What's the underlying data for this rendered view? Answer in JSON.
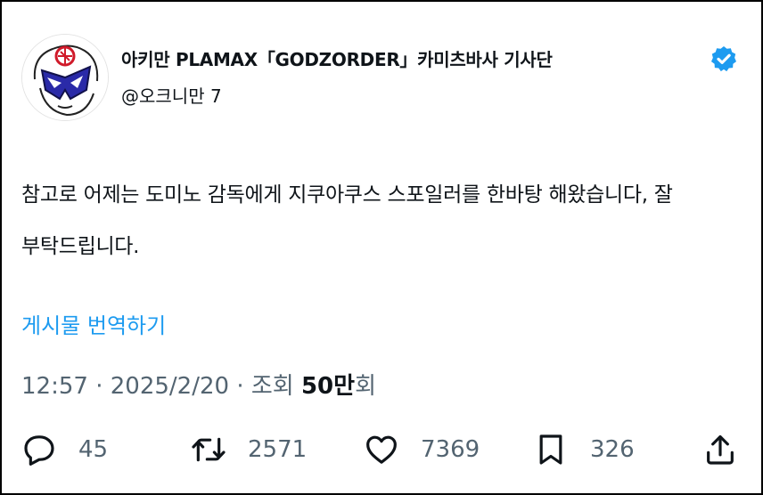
{
  "author": {
    "display_name": "아키만 PLAMAX「GODZORDER」카미츠바사 기사단",
    "handle": "@오크니만 7",
    "verified_icon": "verified-badge-icon",
    "badge_color": "#1d9bf0"
  },
  "tweet": {
    "line1": "참고로 어제는 도미노 감독에게 지쿠아쿠스 스포일러를 한바탕 해왔습니다, 잘",
    "line2": "부탁드립니다.",
    "translate_label": "게시물 번역하기"
  },
  "meta": {
    "time": "12:57",
    "sep1": "·",
    "date": "2025/2/20",
    "sep2": "·",
    "views_label": "조회",
    "views_number": "50만",
    "views_suffix": "회"
  },
  "actions": {
    "reply": {
      "icon": "reply-icon",
      "count": "45"
    },
    "retweet": {
      "icon": "retweet-icon",
      "count": "2571"
    },
    "like": {
      "icon": "heart-icon",
      "count": "7369"
    },
    "bookmark": {
      "icon": "bookmark-icon",
      "count": "326"
    },
    "share": {
      "icon": "share-icon"
    }
  },
  "colors": {
    "link": "#1d9bf0",
    "text": "#0f1419",
    "muted": "#536471"
  }
}
